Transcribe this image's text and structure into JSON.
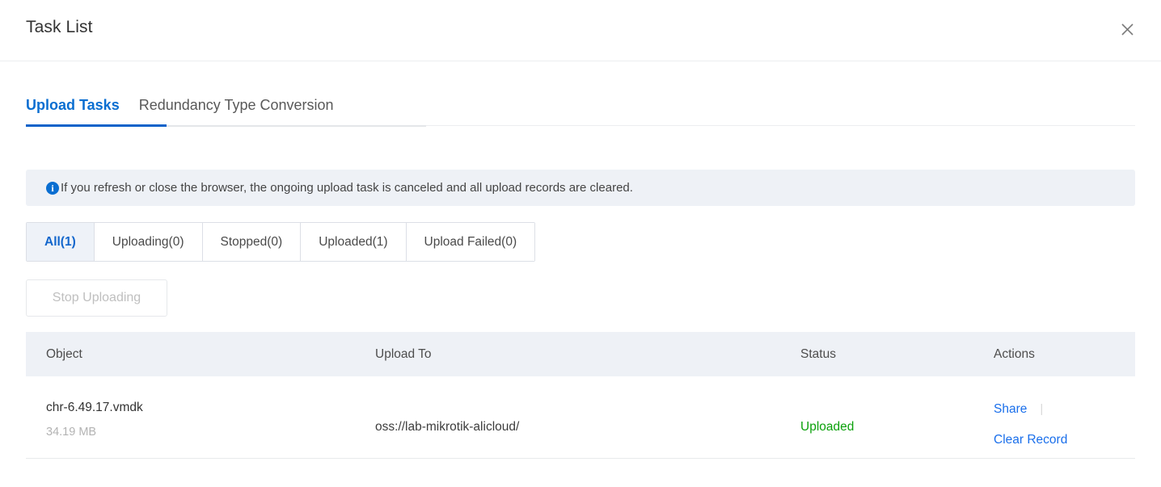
{
  "header": {
    "title": "Task List",
    "close_icon": "close-icon"
  },
  "tabs": [
    {
      "label": "Upload Tasks",
      "active": true
    },
    {
      "label": "Redundancy Type Conversion",
      "active": false
    }
  ],
  "banner": {
    "icon": "info-circle-icon",
    "icon_glyph": "i",
    "text": "If you refresh or close the browser, the ongoing upload task is canceled and all upload records are cleared.",
    "background": "#eef1f6",
    "icon_color": "#0a6ed1"
  },
  "filters": [
    {
      "label": "All(1)",
      "active": true
    },
    {
      "label": "Uploading(0)",
      "active": false
    },
    {
      "label": "Stopped(0)",
      "active": false
    },
    {
      "label": "Uploaded(1)",
      "active": false
    },
    {
      "label": "Upload Failed(0)",
      "active": false
    }
  ],
  "toolbar": {
    "stop_uploading_label": "Stop Uploading",
    "stop_uploading_disabled": true
  },
  "table": {
    "columns": [
      "Object",
      "Upload To",
      "Status",
      "Actions"
    ],
    "rows": [
      {
        "object_name": "chr-6.49.17.vmdk",
        "object_size": "34.19 MB",
        "upload_to": "oss://lab-mikrotik-alicloud/",
        "status": "Uploaded",
        "status_color": "#0ba10b",
        "actions": [
          "Share",
          "Clear Record"
        ],
        "action_separator": "|"
      }
    ]
  },
  "colors": {
    "accent_blue": "#0a6ed1",
    "link_blue": "#1a6feb",
    "success_green": "#0ba10b",
    "header_bg": "#eef1f6",
    "active_tab_underline": "#0a62c9"
  }
}
